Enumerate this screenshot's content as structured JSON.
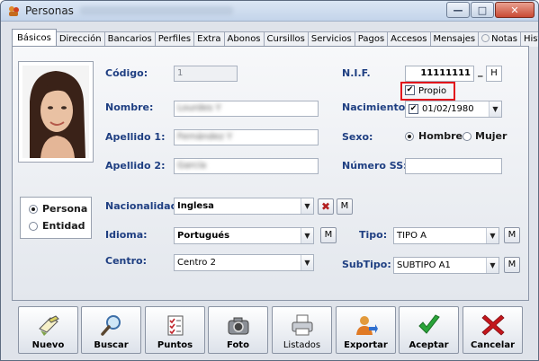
{
  "window": {
    "title": "Personas"
  },
  "tabs": [
    "Básicos",
    "Dirección",
    "Bancarios",
    "Perfiles",
    "Extra",
    "Abonos",
    "Cursillos",
    "Servicios",
    "Pagos",
    "Accesos",
    "Mensajes",
    "Notas",
    "Historial"
  ],
  "form": {
    "codigo_label": "Código:",
    "codigo_value": "1",
    "nombre_label": "Nombre:",
    "nombre_value": "Lourdes Y",
    "apellido1_label": "Apellido 1:",
    "apellido1_value": "Fernández Y",
    "apellido2_label": "Apellido 2:",
    "apellido2_value": "García",
    "nif_label": "N.I.F.",
    "nif_value": "11111111",
    "nif_letter": "H",
    "nif_separator": "_",
    "propio_label": "Propio",
    "nacimiento_label": "Nacimiento:",
    "nacimiento_value": "01/02/1980",
    "sexo_label": "Sexo:",
    "sexo_hombre": "Hombre",
    "sexo_mujer": "Mujer",
    "numero_ss_label": "Número SS:",
    "numero_ss_value": "",
    "tipo_persona": "Persona",
    "tipo_entidad": "Entidad",
    "nacionalidad_label": "Nacionalidad:",
    "nacionalidad_value": "Inglesa",
    "idioma_label": "Idioma:",
    "idioma_value": "Portugués",
    "centro_label": "Centro:",
    "centro_value": "Centro 2",
    "tipo_label": "Tipo:",
    "tipo_value": "TIPO A",
    "subtipo_label": "SubTipo:",
    "subtipo_value": "SUBTIPO A1",
    "m_label": "M"
  },
  "toolbar": {
    "nuevo": "Nuevo",
    "buscar": "Buscar",
    "puntos": "Puntos",
    "foto": "Foto",
    "listados": "Listados",
    "exportar": "Exportar",
    "aceptar": "Aceptar",
    "cancelar": "Cancelar"
  },
  "colors": {
    "label_blue": "#1f3f82",
    "highlight_red": "#e2151c",
    "accent_green": "#2aa53a",
    "cancel_red": "#c4161c"
  }
}
